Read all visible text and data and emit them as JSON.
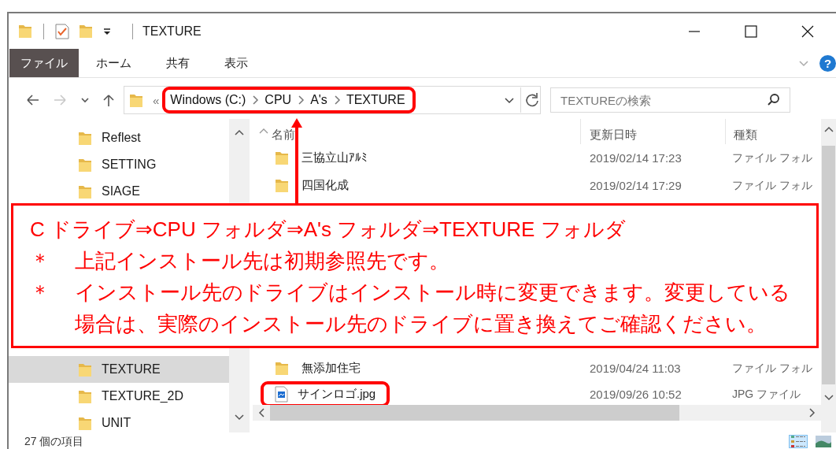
{
  "window": {
    "title": "TEXTURE"
  },
  "ribbon": {
    "tabs": [
      {
        "label": "ファイル",
        "kind": "file"
      },
      {
        "label": "ホーム",
        "kind": "tab"
      },
      {
        "label": "共有",
        "kind": "tab"
      },
      {
        "label": "表示",
        "kind": "tab"
      }
    ],
    "help": "?"
  },
  "navigation": [
    {
      "kind": "back",
      "disabled": false
    },
    {
      "kind": "forward",
      "disabled": true
    },
    {
      "kind": "recent",
      "disabled": false
    },
    {
      "kind": "up",
      "disabled": false
    }
  ],
  "address": {
    "overflow": "«",
    "path": [
      "Windows (C:)",
      "CPU",
      "A's",
      "TEXTURE"
    ]
  },
  "search": {
    "placeholder": "TEXTUREの検索"
  },
  "sidebar": {
    "groups": [
      {
        "items": [
          {
            "label": "Reflest",
            "selected": false
          },
          {
            "label": "SETTING",
            "selected": false
          },
          {
            "label": "SIAGE",
            "selected": false
          }
        ]
      },
      {
        "items": [
          {
            "label": "TEXTURE",
            "selected": true
          },
          {
            "label": "TEXTURE_2D",
            "selected": false
          },
          {
            "label": "UNIT",
            "selected": false
          }
        ]
      }
    ]
  },
  "file_list": {
    "columns": [
      {
        "label": "名前",
        "sorted": true
      },
      {
        "label": "更新日時",
        "sorted": false
      },
      {
        "label": "種類",
        "sorted": false
      }
    ],
    "groups": [
      {
        "rows": [
          {
            "kind": "folder",
            "name": "三協立山ｱﾙﾐ",
            "modified": "2019/02/14 17:23",
            "type": "ファイル フォル",
            "highlighted": false
          },
          {
            "kind": "folder",
            "name": "四国化成",
            "modified": "2019/02/14 17:29",
            "type": "ファイル フォル",
            "highlighted": false
          }
        ]
      },
      {
        "rows": [
          {
            "kind": "folder",
            "name": "無添加住宅",
            "modified": "2019/04/24 11:03",
            "type": "ファイル フォル",
            "highlighted": false
          },
          {
            "kind": "image",
            "name": "サインロゴ.jpg",
            "modified": "2019/09/26 10:52",
            "type": "JPG ファイル",
            "highlighted": true
          }
        ]
      }
    ]
  },
  "status_bar": {
    "item_count": "27 個の項目",
    "views": [
      {
        "kind": "details",
        "selected": true
      },
      {
        "kind": "large-icons",
        "selected": false
      }
    ]
  },
  "annotation": {
    "title": "C ドライブ⇒CPU フォルダ⇒A's フォルダ⇒TEXTURE フォルダ",
    "notes": [
      {
        "mark": "＊",
        "text": "上記インストール先は初期参照先です。"
      },
      {
        "mark": "＊",
        "text": "インストール先のドライブはインストール時に変更できます。変更している場合は、実際のインストール先のドライブに置き換えてご確認ください。"
      }
    ]
  }
}
